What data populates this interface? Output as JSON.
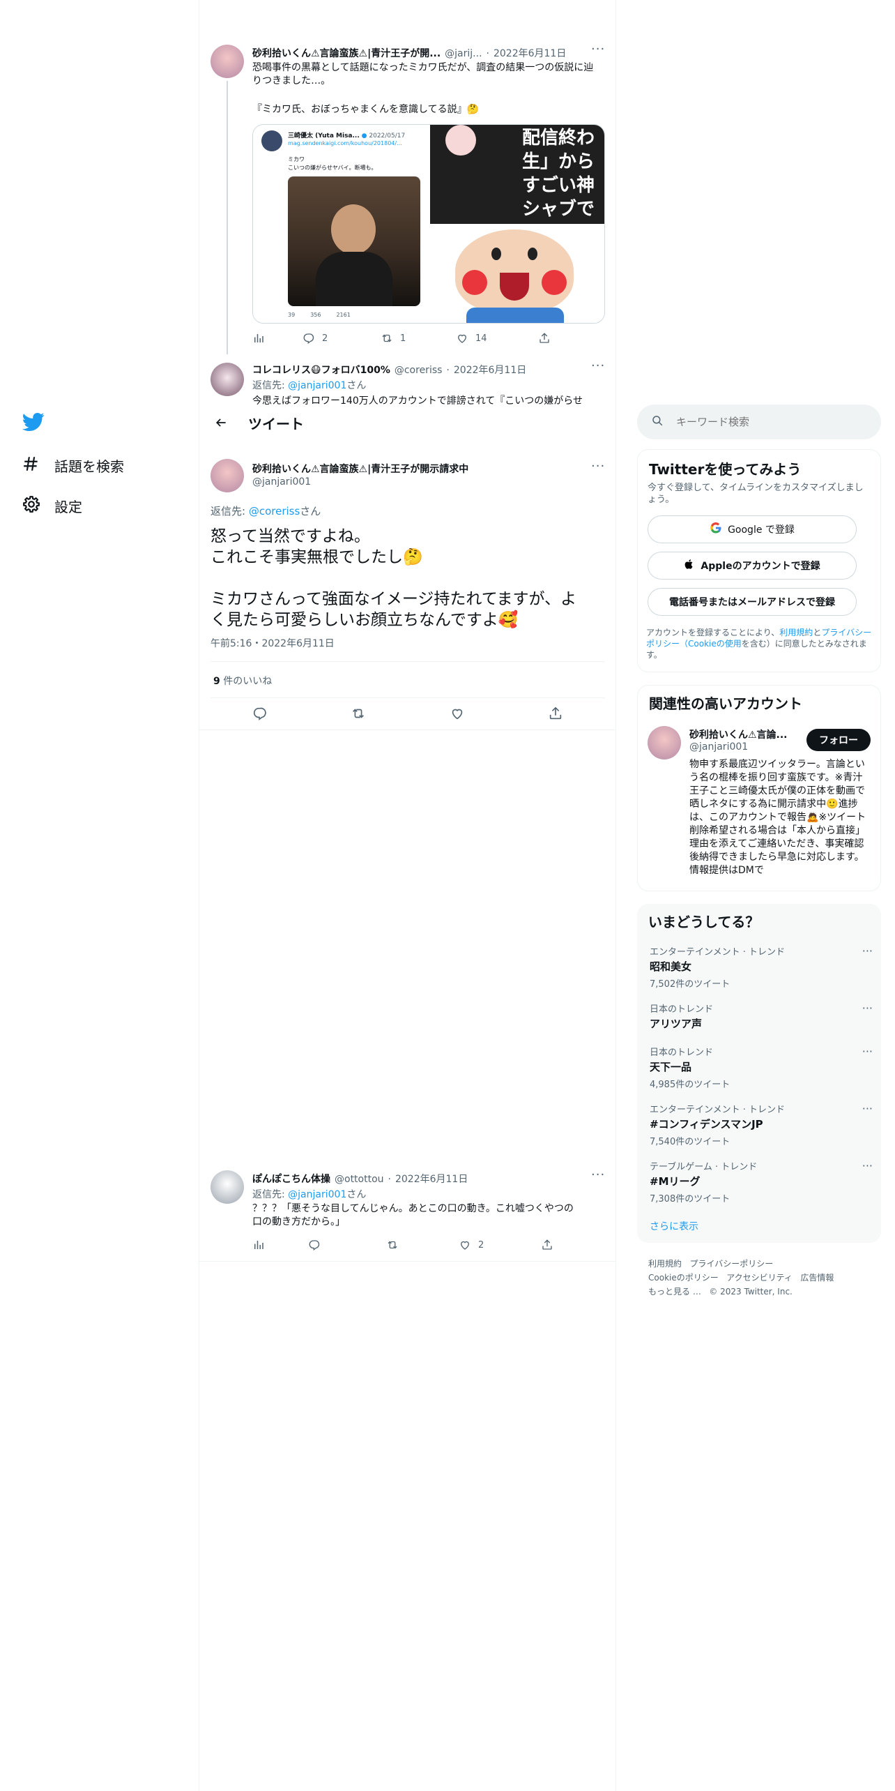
{
  "nav": {
    "items": [
      {
        "label": "話題を検索",
        "icon": "hashtag-icon"
      },
      {
        "label": "設定",
        "icon": "gear-icon"
      }
    ]
  },
  "header": {
    "title": "ツイート"
  },
  "thread": {
    "tweet1": {
      "name": "砂利拾いくん⚠言論蛮族⚠|青汁王子が開...",
      "handle": "@jarij...",
      "date": "2022年6月11日",
      "text_line1": "恐喝事件の黒幕として話題になったミカワ氏だが、調査の結果一つの仮説に辿りつきました…。",
      "text_line2": "『ミカワ氏、おぼっちゃまくんを意識してる説』🤔",
      "embed": {
        "name": "三崎優太 (Yuta Misa...",
        "date": "2022/05/17",
        "url": "mag.sendenkaigi.com/kouhou/201804/...",
        "body1": "ミカワ",
        "body2": "こいつの嫌がらせヤバイ。断場も。",
        "stats": [
          "39",
          "356",
          "2161"
        ]
      },
      "overlay_text": [
        "配信終わ",
        "生」から",
        "すごい神",
        "シャブで"
      ],
      "stats": {
        "replies": "2",
        "retweets": "1",
        "likes": "14"
      }
    },
    "tweet2": {
      "name": "コレコレリス😷フォロバ100%",
      "handle": "@coreriss",
      "date": "2022年6月11日",
      "reply_prefix": "返信先: ",
      "reply_to": "@janjari001",
      "reply_suffix": "さん",
      "text": "今思えばフォロワー140万人のアカウントで誹謗されて『こいつの嫌がらせ"
    },
    "main_tweet": {
      "name": "砂利拾いくん⚠言論蛮族⚠|青汁王子が開示請求中",
      "handle": "@janjari001",
      "reply_prefix": "返信先: ",
      "reply_to": "@coreriss",
      "reply_suffix": "さん",
      "line1": "怒って当然ですよね。",
      "line2": "これこそ事実無根でしたし🤔",
      "line3": "ミカワさんって強面なイメージ持たれてますが、よ",
      "line4": "く見たら可愛らしいお顔立ちなんですよ🥰",
      "timestamp": "午前5:16・2022年6月11日",
      "likes_count": "9",
      "likes_label": " 件のいいね"
    },
    "reply": {
      "name": "ぽんぽこちん体操",
      "handle": "@ottottou",
      "date": "2022年6月11日",
      "reply_prefix": "返信先: ",
      "reply_to": "@janjari001",
      "reply_suffix": "さん",
      "text1": "？？？「悪そうな目してんじゃん。あとこの口の動き。これ嘘つくやつの",
      "text2": "口の動き方だから。」",
      "likes": "2"
    }
  },
  "search": {
    "placeholder": "キーワード検索"
  },
  "signup": {
    "title": "Twitterを使ってみよう",
    "subtitle": "今すぐ登録して、タイムラインをカスタマイズしましょう。",
    "google": "Google で登録",
    "apple": "Appleのアカウントで登録",
    "phone": "電話番号またはメールアドレスで登録",
    "terms_1": "アカウントを登録することにより、",
    "terms_link1": "利用規約",
    "terms_2": "と",
    "terms_link2": "プライバシーポリシー（Cookieの使用",
    "terms_3": "を含む）に同意したとみなされます。"
  },
  "related": {
    "title": "関連性の高いアカウント",
    "name": "砂利拾いくん⚠言論...",
    "handle": "@janjari001",
    "follow": "フォロー",
    "bio": "物申す系最底辺ツイッタラー。言論という名の棍棒を振り回す蛮族です。※青汁王子こと三崎優太氏が僕の正体を動画で晒しネタにする為に開示請求中🙂進捗は、このアカウントで報告🙇※ツイート削除希望される場合は「本人から直接」理由を添えてご連絡いただき、事実確認後納得できましたら早急に対応します。情報提供はDMで"
  },
  "trends": {
    "title": "いまどうしてる？",
    "items": [
      {
        "cat": "エンターテインメント · トレンド",
        "title": "昭和美女",
        "count": "7,502件のツイート"
      },
      {
        "cat": "日本のトレンド",
        "title": "アリツア声",
        "count": ""
      },
      {
        "cat": "日本のトレンド",
        "title": "天下一品",
        "count": "4,985件のツイート"
      },
      {
        "cat": "エンターテインメント · トレンド",
        "title": "#コンフィデンスマンJP",
        "count": "7,540件のツイート"
      },
      {
        "cat": "テーブルゲーム · トレンド",
        "title": "#Mリーグ",
        "count": "7,308件のツイート"
      }
    ],
    "show_more": "さらに表示"
  },
  "footer": {
    "links": [
      "利用規約",
      "プライバシーポリシー",
      "Cookieのポリシー",
      "アクセシビリティ",
      "広告情報",
      "もっと見る …"
    ],
    "copyright": "© 2023 Twitter, Inc."
  },
  "colors": {
    "accent": "#1d9bf0",
    "text": "#0f1419",
    "muted": "#536471"
  }
}
